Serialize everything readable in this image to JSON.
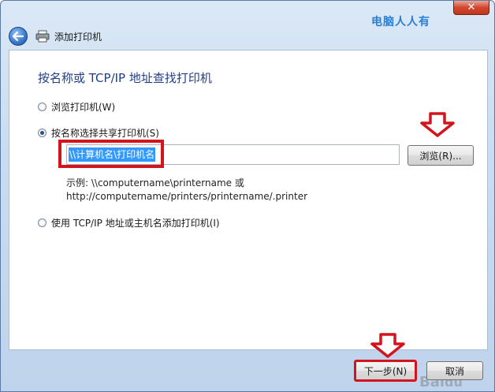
{
  "window": {
    "close_label": "✕",
    "watermark_top": "电脑人人有"
  },
  "header": {
    "title": "添加打印机"
  },
  "main": {
    "heading": "按名称或 TCP/IP 地址查找打印机",
    "options": [
      {
        "label": "浏览打印机(W)",
        "checked": false
      },
      {
        "label": "按名称选择共享打印机(S)",
        "checked": true
      },
      {
        "label": "使用 TCP/IP 地址或主机名添加打印机(I)",
        "checked": false
      }
    ],
    "name_input_value": "\\\\计算机名\\打印机名",
    "browse_label": "浏览(R)...",
    "example_line1": "示例: \\\\computername\\printername 或",
    "example_line2": "http://computername/printers/printername/.printer"
  },
  "footer": {
    "next_label": "下一步(N)",
    "cancel_label": "取消"
  },
  "colors": {
    "accent_red": "#d4141c",
    "heading_blue": "#1e3f8a",
    "selection_blue": "#3399ff"
  }
}
